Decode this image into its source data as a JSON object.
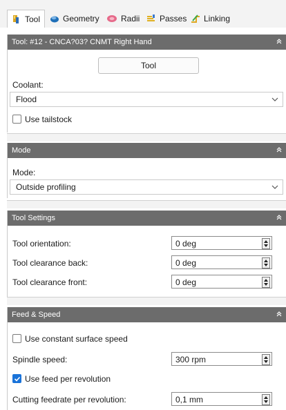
{
  "tabs": [
    {
      "label": "Tool",
      "icon": "tool-icon",
      "active": true
    },
    {
      "label": "Geometry",
      "icon": "geometry-icon"
    },
    {
      "label": "Radii",
      "icon": "radii-icon"
    },
    {
      "label": "Passes",
      "icon": "passes-icon"
    },
    {
      "label": "Linking",
      "icon": "linking-icon"
    }
  ],
  "tool_section": {
    "header": "Tool: #12 - CNCA?03? CNMT Right Hand",
    "tool_button": "Tool",
    "coolant_label": "Coolant:",
    "coolant_value": "Flood",
    "tailstock_label": "Use tailstock",
    "tailstock_checked": false
  },
  "mode_section": {
    "header": "Mode",
    "mode_label": "Mode:",
    "mode_value": "Outside profiling"
  },
  "tool_settings": {
    "header": "Tool Settings",
    "rows": [
      {
        "label": "Tool orientation:",
        "value": "0 deg"
      },
      {
        "label": "Tool clearance back:",
        "value": "0 deg"
      },
      {
        "label": "Tool clearance front:",
        "value": "0 deg"
      }
    ]
  },
  "feed_speed": {
    "header": "Feed & Speed",
    "css_label": "Use constant surface speed",
    "css_checked": false,
    "spindle_label": "Spindle speed:",
    "spindle_value": "300 rpm",
    "fpr_label": "Use feed per revolution",
    "fpr_checked": true,
    "cutting_label": "Cutting feedrate per revolution:",
    "cutting_value": "0,1 mm"
  },
  "colors": {
    "header_bg": "#6c6c6c",
    "accent": "#1a73d9",
    "tabbar_bg": "#f3f3f3"
  }
}
